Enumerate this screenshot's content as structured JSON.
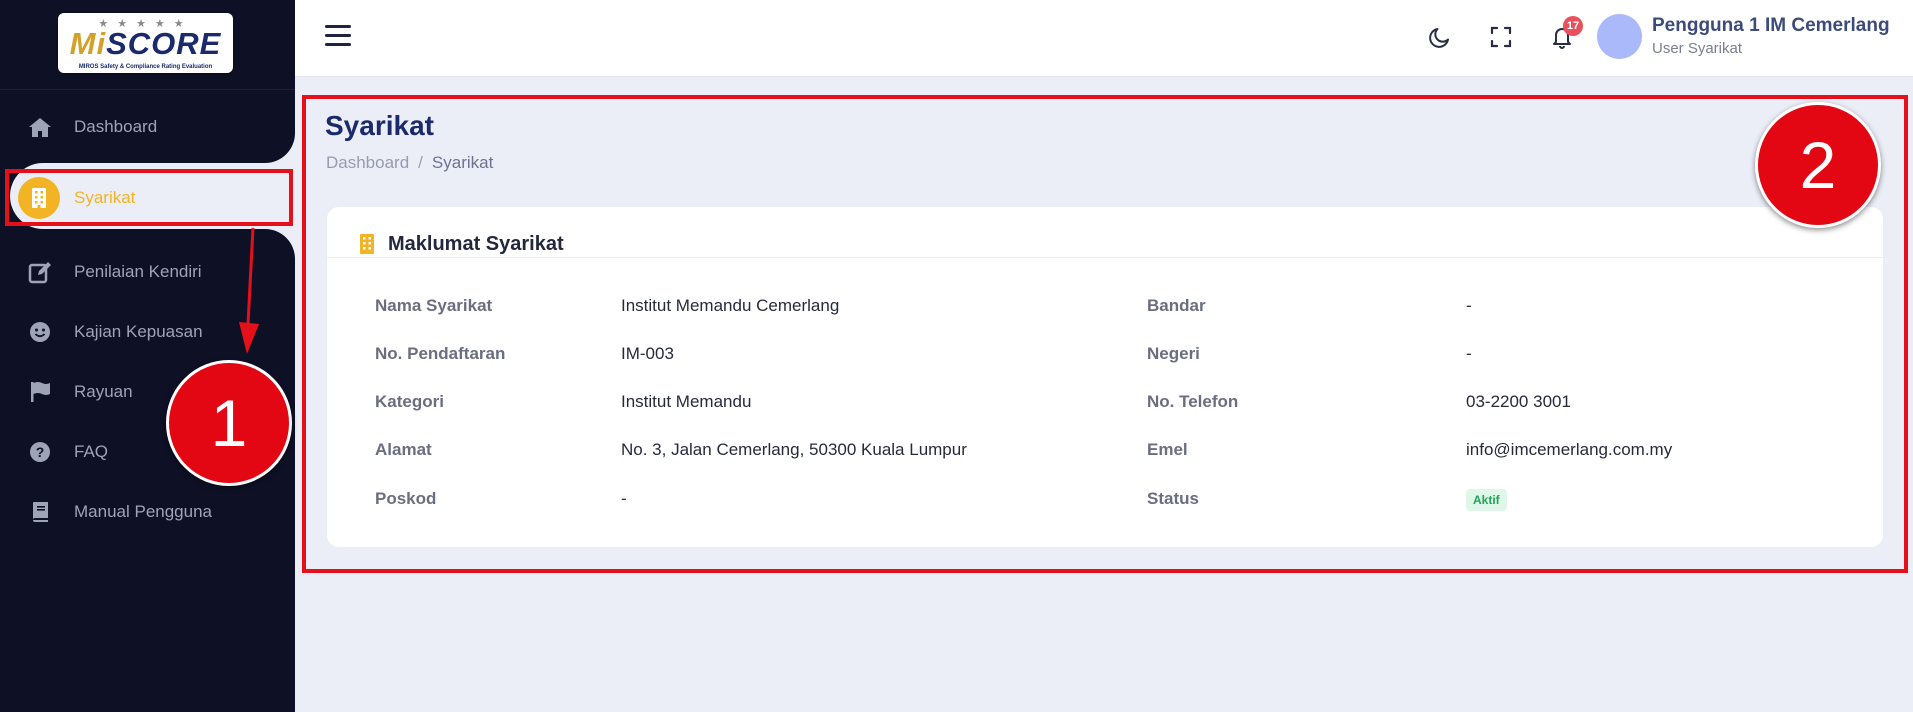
{
  "app": {
    "logo_text_prefix": "Mi",
    "logo_text_main": "SCORE",
    "logo_stars": "★★★★★",
    "logo_subtitle": "MIROS Safety & Compliance Rating Evaluation"
  },
  "sidebar": {
    "items": [
      {
        "label": "Dashboard",
        "icon": "home-icon"
      },
      {
        "label": "Syarikat",
        "icon": "building-icon",
        "active": true
      },
      {
        "label": "Penilaian Kendiri",
        "icon": "edit-icon"
      },
      {
        "label": "Kajian Kepuasan",
        "icon": "smile-icon"
      },
      {
        "label": "Rayuan",
        "icon": "flag-icon"
      },
      {
        "label": "FAQ",
        "icon": "question-icon"
      },
      {
        "label": "Manual Pengguna",
        "icon": "book-icon"
      }
    ]
  },
  "header": {
    "notification_count": "17",
    "user_name": "Pengguna 1 IM Cemerlang",
    "user_role": "User Syarikat"
  },
  "page": {
    "title": "Syarikat",
    "breadcrumb": [
      "Dashboard",
      "/",
      "Syarikat"
    ]
  },
  "card": {
    "title": "Maklumat Syarikat",
    "left_fields": [
      {
        "label": "Nama Syarikat",
        "value": "Institut Memandu Cemerlang"
      },
      {
        "label": "No. Pendaftaran",
        "value": "IM-003"
      },
      {
        "label": "Kategori",
        "value": "Institut Memandu"
      },
      {
        "label": "Alamat",
        "value": "No. 3, Jalan Cemerlang, 50300 Kuala Lumpur"
      },
      {
        "label": "Poskod",
        "value": "-"
      }
    ],
    "right_fields": [
      {
        "label": "Bandar",
        "value": "-"
      },
      {
        "label": "Negeri",
        "value": "-"
      },
      {
        "label": "No. Telefon",
        "value": "03-2200 3001"
      },
      {
        "label": "Emel",
        "value": "info@imcemerlang.com.my"
      },
      {
        "label": "Status",
        "value": "Aktif"
      }
    ]
  },
  "annotations": {
    "callout_1": "1",
    "callout_2": "2",
    "highlight_color": "#e5101a"
  },
  "colors": {
    "sidebar_bg": "#0e1126",
    "accent": "#f2b324",
    "title": "#1b2a6b",
    "status_active": "#22a35a"
  }
}
